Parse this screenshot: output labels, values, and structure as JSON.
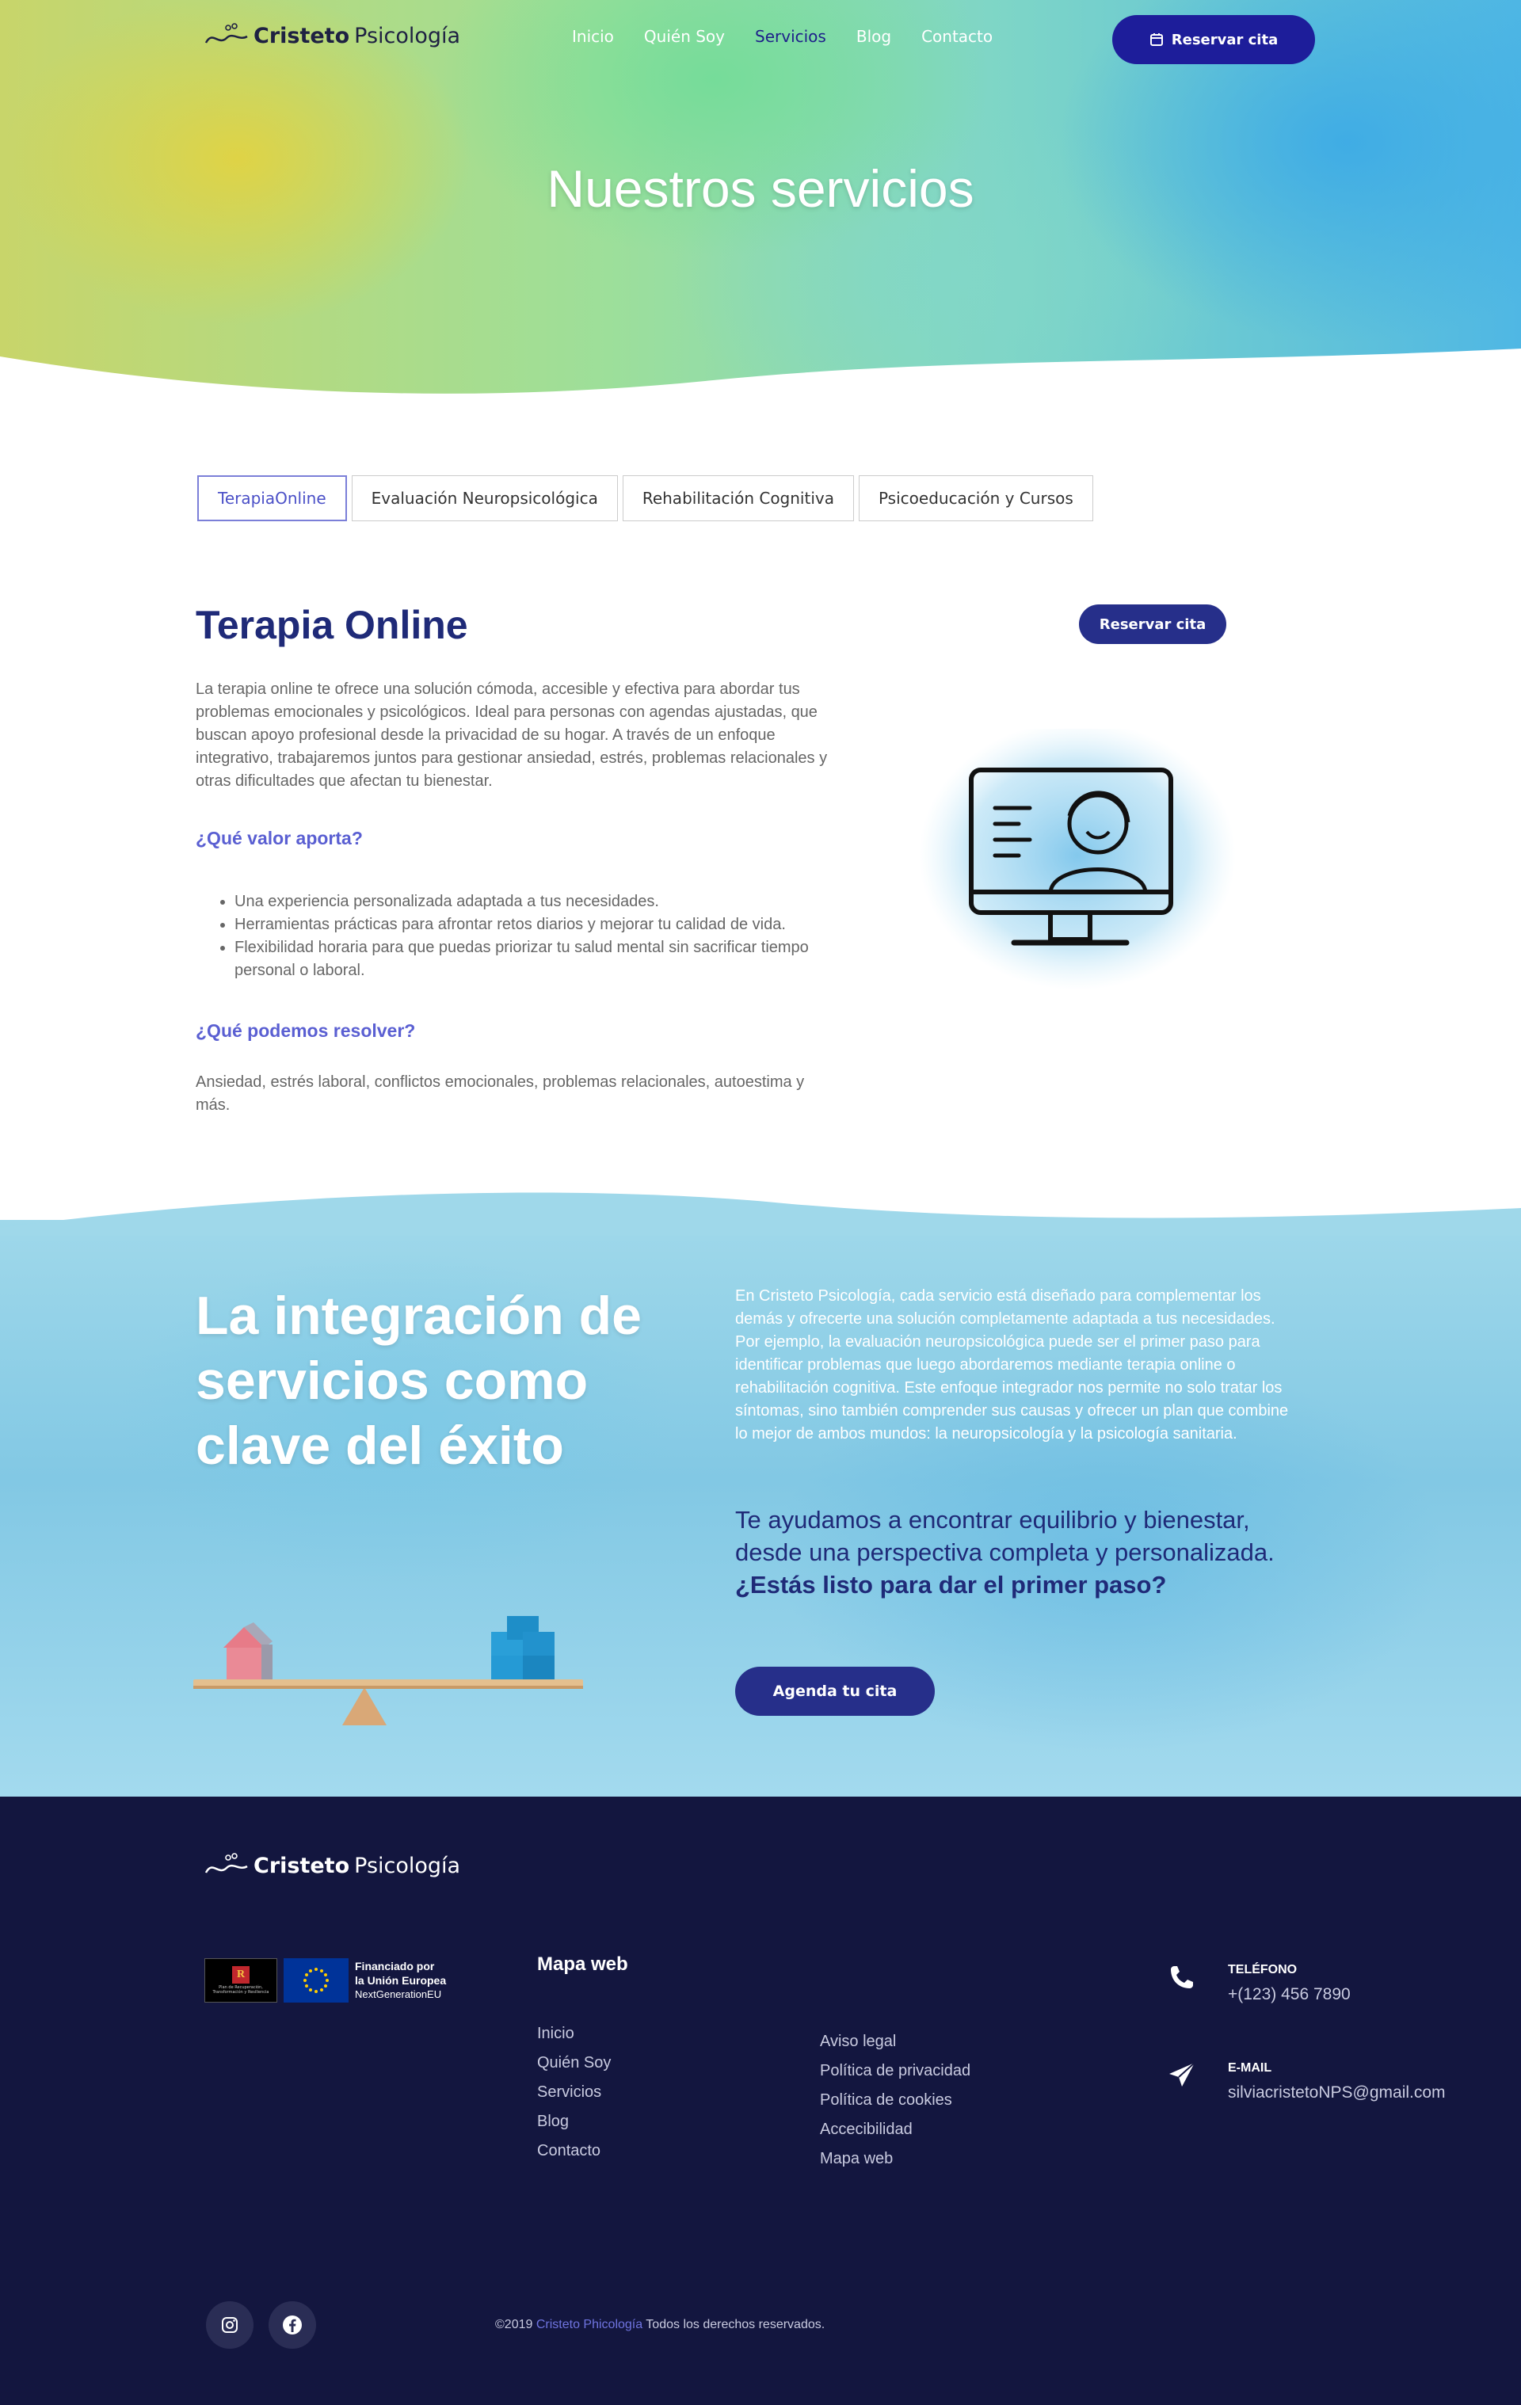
{
  "header": {
    "brand_bold": "Cristeto",
    "brand_light": "Psicología",
    "nav": [
      {
        "label": "Inicio",
        "active": false
      },
      {
        "label": "Quién Soy",
        "active": false
      },
      {
        "label": "Servicios",
        "active": true
      },
      {
        "label": "Blog",
        "active": false
      },
      {
        "label": "Contacto",
        "active": false
      }
    ],
    "cta_label": "Reservar cita",
    "cta_icon": "calendar-icon"
  },
  "hero": {
    "title": "Nuestros servicios"
  },
  "tabs": [
    {
      "label": "TerapiaOnline",
      "active": true
    },
    {
      "label": "Evaluación Neuropsicológica",
      "active": false
    },
    {
      "label": "Rehabilitación Cognitiva",
      "active": false
    },
    {
      "label": "Psicoeducación y Cursos",
      "active": false
    }
  ],
  "service": {
    "title": "Terapia Online",
    "cta_label": "Reservar cita",
    "intro": "La terapia online te ofrece una solución cómoda, accesible y efectiva para abordar tus problemas emocionales y psicológicos. Ideal para personas con agendas ajustadas, que buscan apoyo profesional desde la privacidad de su hogar. A través de un enfoque integrativo, trabajaremos juntos para gestionar ansiedad, estrés, problemas relacionales y otras dificultades que afectan tu bienestar.",
    "value_heading": "¿Qué valor aporta?",
    "value_items": [
      "Una experiencia personalizada adaptada a tus necesidades.",
      "Herramientas prácticas para afrontar retos diarios y mejorar tu calidad de vida.",
      "Flexibilidad horaria para que puedas priorizar tu salud mental sin sacrificar tiempo personal o laboral."
    ],
    "resolve_heading": "¿Qué podemos resolver?",
    "resolve_text": "Ansiedad, estrés laboral, conflictos emocionales, problemas relacionales, autoestima y más.",
    "illustration_icon": "online-therapy-monitor-icon"
  },
  "integration": {
    "title": "La integración de servicios como clave del éxito",
    "paragraph": "En Cristeto Psicología, cada servicio está diseñado para complementar los demás y ofrecerte una solución completamente adaptada a tus necesidades. Por ejemplo, la evaluación neuropsicológica puede ser el primer paso para identificar problemas que luego abordaremos mediante terapia online o rehabilitación cognitiva. Este enfoque integrador nos permite no solo tratar los síntomas, sino también comprender sus causas y ofrecer un plan que combine lo mejor de ambos mundos: la neuropsicología y la psicología sanitaria.",
    "lead_regular": "Te ayudamos a encontrar equilibrio y bienestar, desde una perspectiva completa y personalizada.",
    "lead_bold": "¿Estás listo para dar el primer paso?",
    "cta_label": "Agenda tu cita"
  },
  "footer": {
    "brand_bold": "Cristeto",
    "brand_light": "Psicología",
    "funding_box_text": "Plan de Recuperación, Transformación y Resiliencia",
    "funding_line1": "Financiado por",
    "funding_line2": "la Unión Europea",
    "funding_line3": "NextGenerationEU",
    "map_title": "Mapa web",
    "links_main": [
      "Inicio",
      "Quién Soy",
      "Servicios",
      "Blog",
      "Contacto"
    ],
    "links_legal": [
      "Aviso legal",
      "Política de privacidad",
      "Política de cookies",
      "Accecibilidad",
      "Mapa web"
    ],
    "phone_label": "TELÉFONO",
    "phone_value": "+(123) 456 7890",
    "email_label": "E-MAIL",
    "email_value": "silviacristetoNPS@gmail.com",
    "copyright_prefix": "©2019",
    "copyright_brand": "Cristeto Phicología",
    "copyright_suffix": "Todos los derechos reservados.",
    "social": [
      "instagram-icon",
      "facebook-icon"
    ]
  },
  "colors": {
    "accent": "#1d1d9a",
    "title_blue": "#1f2a78",
    "link_purple": "#5a5fd2",
    "footer_bg": "#13163f"
  }
}
